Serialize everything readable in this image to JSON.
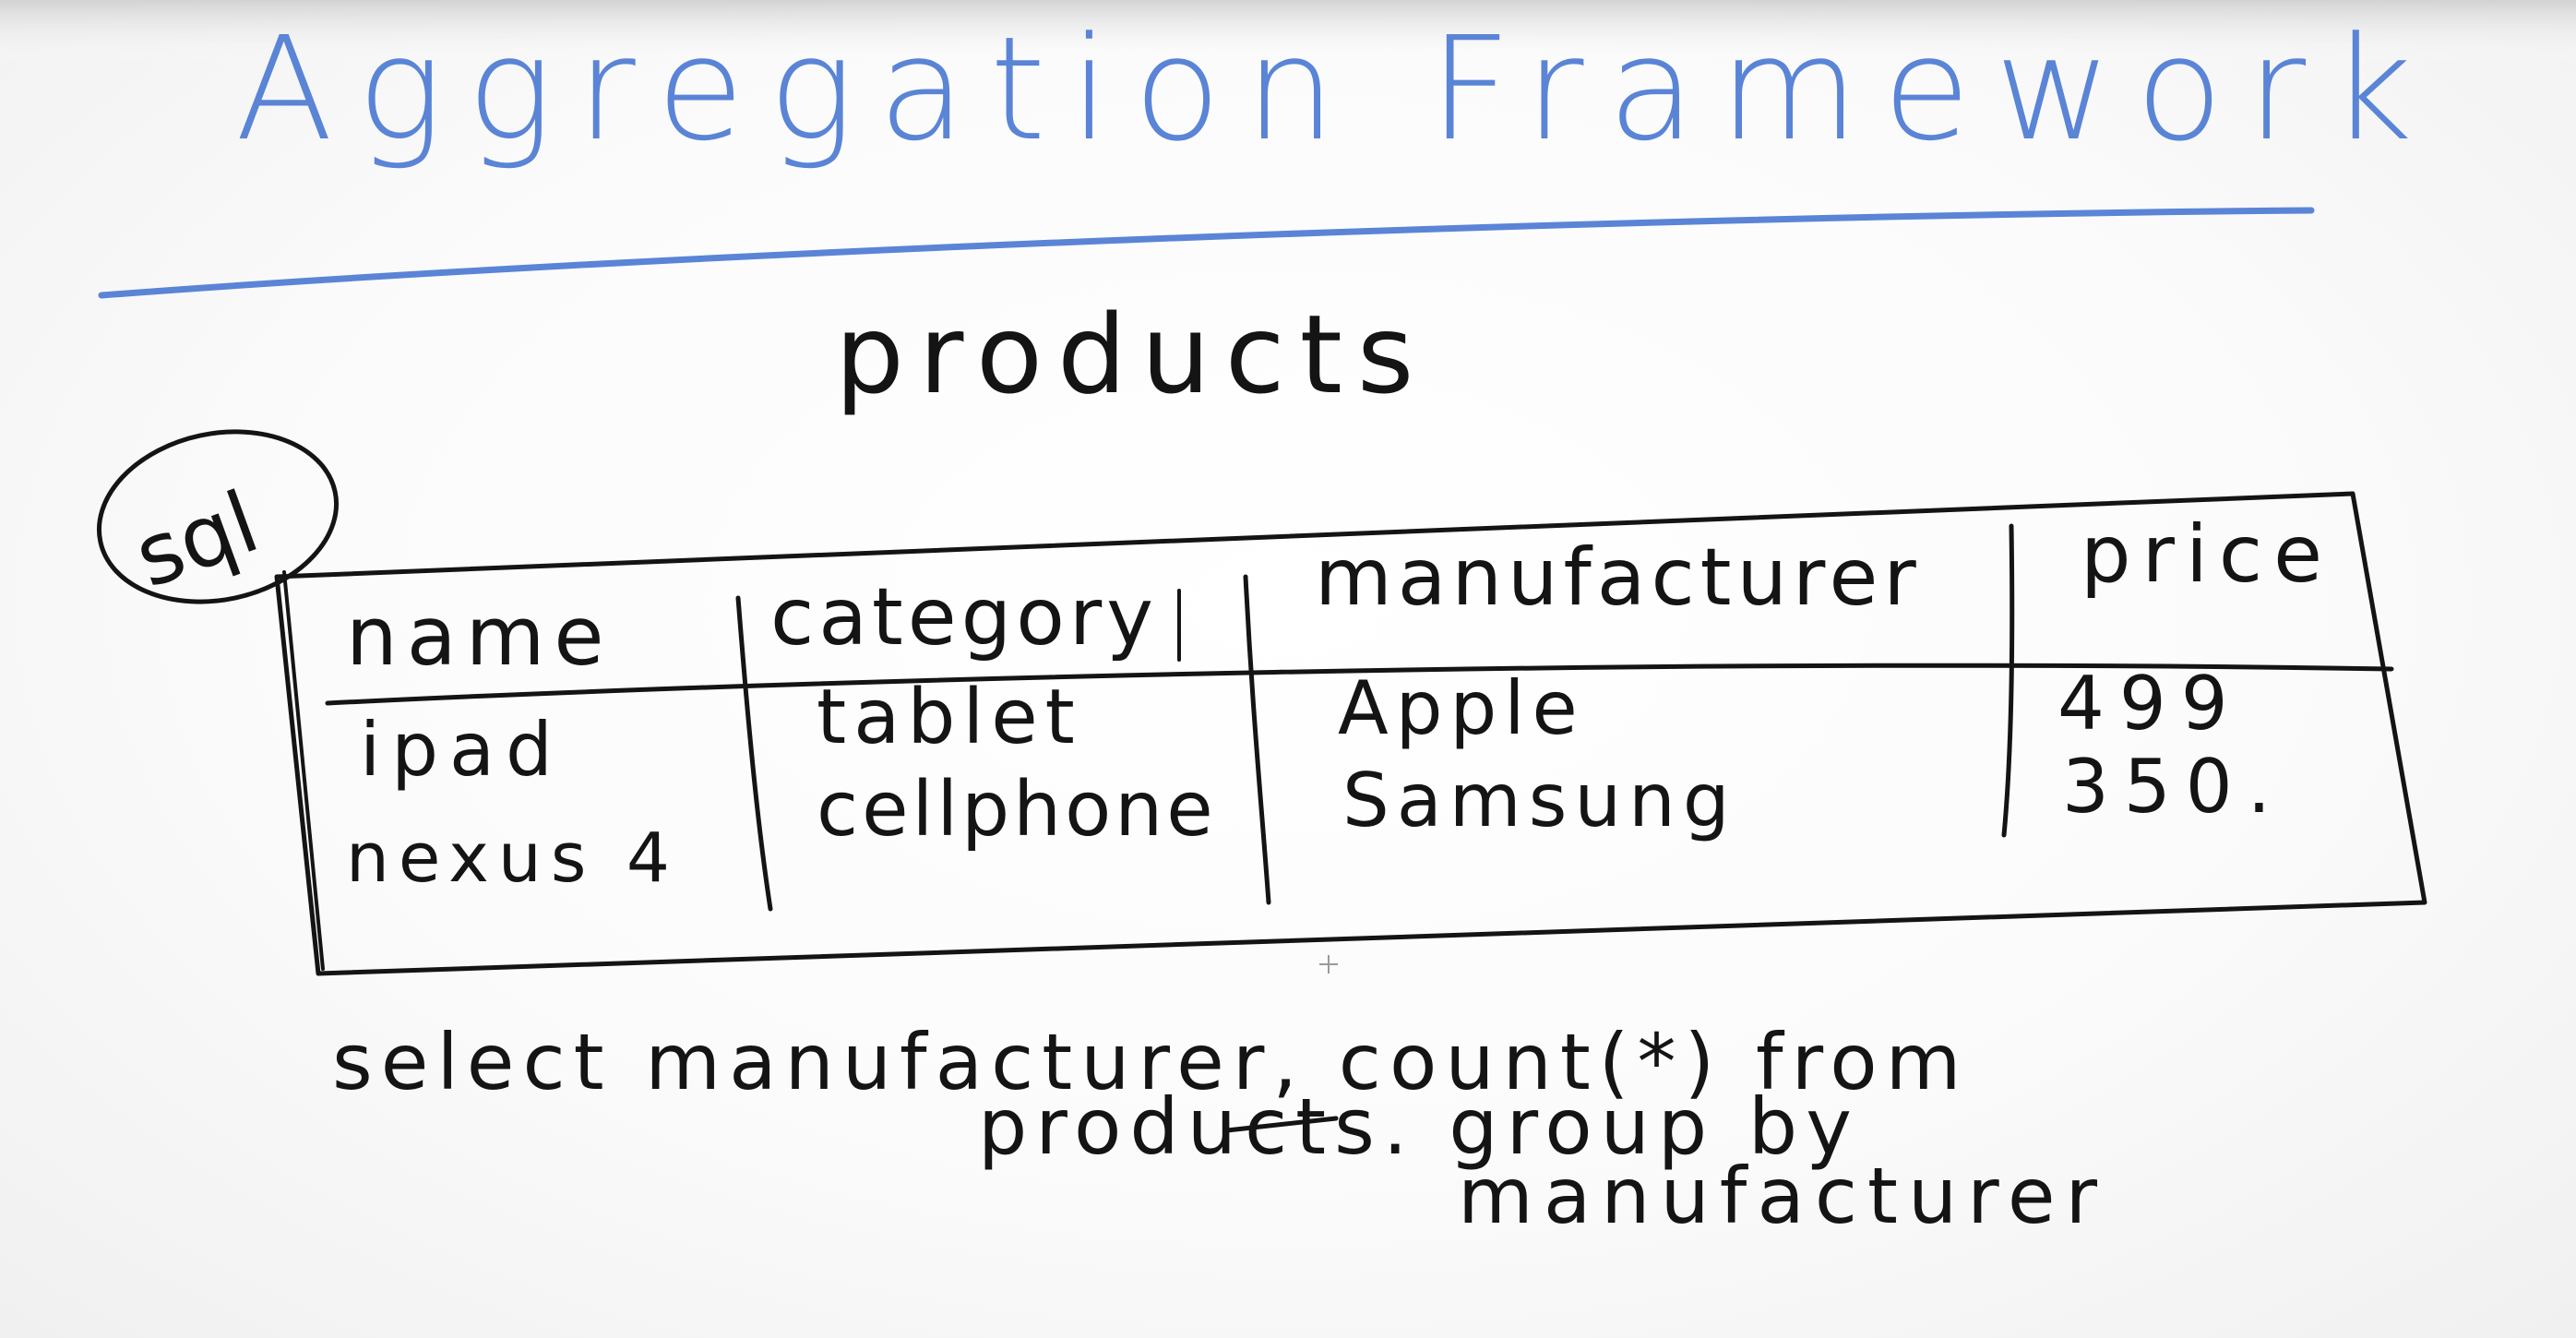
{
  "title": "Aggregation Framework",
  "collection_label": "products",
  "badge_label": "sql",
  "table": {
    "headers": [
      "name",
      "category",
      "manufacturer",
      "price"
    ],
    "rows": [
      [
        "ipad",
        "tablet",
        "Apple",
        "499"
      ],
      [
        "nexus 4",
        "cellphone",
        "Samsung",
        "350."
      ]
    ]
  },
  "query": {
    "line1": "select manufacturer, count(*) from",
    "line2": "products. group by",
    "line3": "manufacturer"
  },
  "colors": {
    "title_ink": "#5a84d6",
    "body_ink": "#141414",
    "background": "#ffffff"
  }
}
